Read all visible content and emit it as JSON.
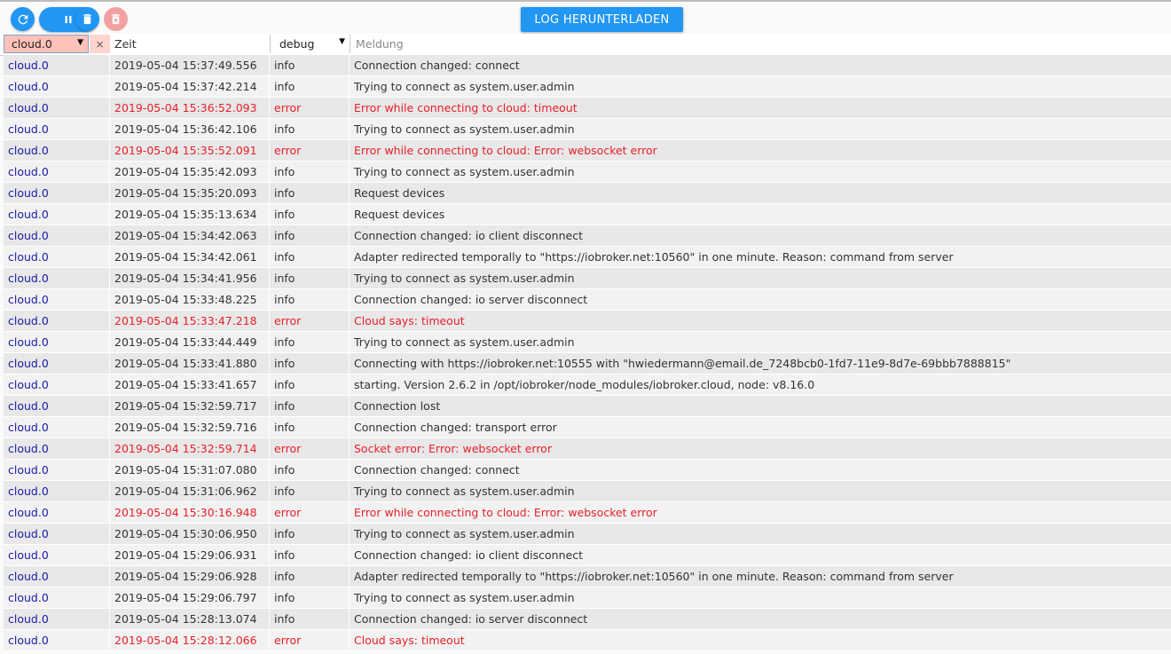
{
  "toolbar": {
    "download_label": "LOG HERUNTERLADEN"
  },
  "filters": {
    "source_value": "cloud.0",
    "clear_symbol": "×",
    "time_placeholder": "Zeit",
    "severity_value": "debug",
    "message_placeholder": "Meldung"
  },
  "icons": {
    "refresh": "refresh-icon",
    "pause": "pause-icon",
    "delete": "delete-icon",
    "delete_forever": "delete-forever-icon"
  },
  "colors": {
    "accent": "#2196f3",
    "error_text": "#e8202a",
    "source_text": "#1a1aa6",
    "filter_active": "#ffc2b8"
  },
  "log": [
    {
      "source": "cloud.0",
      "time": "2019-05-04 15:37:49.556",
      "severity": "info",
      "message": "Connection changed: connect"
    },
    {
      "source": "cloud.0",
      "time": "2019-05-04 15:37:42.214",
      "severity": "info",
      "message": "Trying to connect as system.user.admin"
    },
    {
      "source": "cloud.0",
      "time": "2019-05-04 15:36:52.093",
      "severity": "error",
      "message": "Error while connecting to cloud: timeout"
    },
    {
      "source": "cloud.0",
      "time": "2019-05-04 15:36:42.106",
      "severity": "info",
      "message": "Trying to connect as system.user.admin"
    },
    {
      "source": "cloud.0",
      "time": "2019-05-04 15:35:52.091",
      "severity": "error",
      "message": "Error while connecting to cloud: Error: websocket error"
    },
    {
      "source": "cloud.0",
      "time": "2019-05-04 15:35:42.093",
      "severity": "info",
      "message": "Trying to connect as system.user.admin"
    },
    {
      "source": "cloud.0",
      "time": "2019-05-04 15:35:20.093",
      "severity": "info",
      "message": "Request devices"
    },
    {
      "source": "cloud.0",
      "time": "2019-05-04 15:35:13.634",
      "severity": "info",
      "message": "Request devices"
    },
    {
      "source": "cloud.0",
      "time": "2019-05-04 15:34:42.063",
      "severity": "info",
      "message": "Connection changed: io client disconnect"
    },
    {
      "source": "cloud.0",
      "time": "2019-05-04 15:34:42.061",
      "severity": "info",
      "message": "Adapter redirected temporally to \"https://iobroker.net:10560\" in one minute. Reason: command from server"
    },
    {
      "source": "cloud.0",
      "time": "2019-05-04 15:34:41.956",
      "severity": "info",
      "message": "Trying to connect as system.user.admin"
    },
    {
      "source": "cloud.0",
      "time": "2019-05-04 15:33:48.225",
      "severity": "info",
      "message": "Connection changed: io server disconnect"
    },
    {
      "source": "cloud.0",
      "time": "2019-05-04 15:33:47.218",
      "severity": "error",
      "message": "Cloud says: timeout"
    },
    {
      "source": "cloud.0",
      "time": "2019-05-04 15:33:44.449",
      "severity": "info",
      "message": "Trying to connect as system.user.admin"
    },
    {
      "source": "cloud.0",
      "time": "2019-05-04 15:33:41.880",
      "severity": "info",
      "message": "Connecting with https://iobroker.net:10555 with \"hwiedermann@email.de_7248bcb0-1fd7-11e9-8d7e-69bbb7888815\""
    },
    {
      "source": "cloud.0",
      "time": "2019-05-04 15:33:41.657",
      "severity": "info",
      "message": "starting. Version 2.6.2 in /opt/iobroker/node_modules/iobroker.cloud, node: v8.16.0"
    },
    {
      "source": "cloud.0",
      "time": "2019-05-04 15:32:59.717",
      "severity": "info",
      "message": "Connection lost"
    },
    {
      "source": "cloud.0",
      "time": "2019-05-04 15:32:59.716",
      "severity": "info",
      "message": "Connection changed: transport error"
    },
    {
      "source": "cloud.0",
      "time": "2019-05-04 15:32:59.714",
      "severity": "error",
      "message": "Socket error: Error: websocket error"
    },
    {
      "source": "cloud.0",
      "time": "2019-05-04 15:31:07.080",
      "severity": "info",
      "message": "Connection changed: connect"
    },
    {
      "source": "cloud.0",
      "time": "2019-05-04 15:31:06.962",
      "severity": "info",
      "message": "Trying to connect as system.user.admin"
    },
    {
      "source": "cloud.0",
      "time": "2019-05-04 15:30:16.948",
      "severity": "error",
      "message": "Error while connecting to cloud: Error: websocket error"
    },
    {
      "source": "cloud.0",
      "time": "2019-05-04 15:30:06.950",
      "severity": "info",
      "message": "Trying to connect as system.user.admin"
    },
    {
      "source": "cloud.0",
      "time": "2019-05-04 15:29:06.931",
      "severity": "info",
      "message": "Connection changed: io client disconnect"
    },
    {
      "source": "cloud.0",
      "time": "2019-05-04 15:29:06.928",
      "severity": "info",
      "message": "Adapter redirected temporally to \"https://iobroker.net:10560\" in one minute. Reason: command from server"
    },
    {
      "source": "cloud.0",
      "time": "2019-05-04 15:29:06.797",
      "severity": "info",
      "message": "Trying to connect as system.user.admin"
    },
    {
      "source": "cloud.0",
      "time": "2019-05-04 15:28:13.074",
      "severity": "info",
      "message": "Connection changed: io server disconnect"
    },
    {
      "source": "cloud.0",
      "time": "2019-05-04 15:28:12.066",
      "severity": "error",
      "message": "Cloud says: timeout"
    }
  ]
}
